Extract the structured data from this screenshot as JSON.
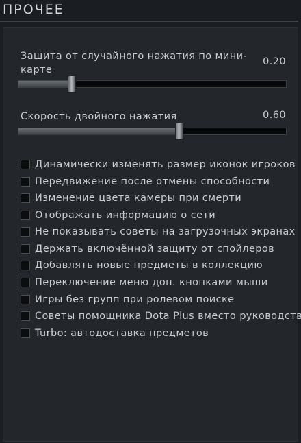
{
  "section": {
    "title": "ПРОЧЕЕ"
  },
  "sliders": [
    {
      "label_line1": "Защита от случайного нажатия по мини-",
      "label_line2": "карте",
      "value": "0.20",
      "level": 0.2
    },
    {
      "label_line1": "Скорость двойного нажатия",
      "value": "0.60",
      "level": 0.6
    }
  ],
  "checkboxes": [
    {
      "label": "Динамически изменять размер иконок игроков",
      "checked": false
    },
    {
      "label": "Передвижение после отмены способности",
      "checked": false
    },
    {
      "label": "Изменение цвета камеры при смерти",
      "checked": false
    },
    {
      "label": "Отображать информацию о сети",
      "checked": false
    },
    {
      "label": "Не показывать советы на загрузочных экранах",
      "checked": false
    },
    {
      "label": "Держать включённой защиту от спойлеров",
      "checked": false
    },
    {
      "label": "Добавлять новые предметы в коллекцию",
      "checked": false
    },
    {
      "label": "Переключение меню доп. кнопками мыши",
      "checked": false
    },
    {
      "label": "Игры без групп при ролевом поиске",
      "checked": false
    },
    {
      "label": "Советы помощника Dota Plus вместо руководств",
      "checked": false
    },
    {
      "label": "Turbo: автодоставка предметов",
      "checked": false
    }
  ]
}
